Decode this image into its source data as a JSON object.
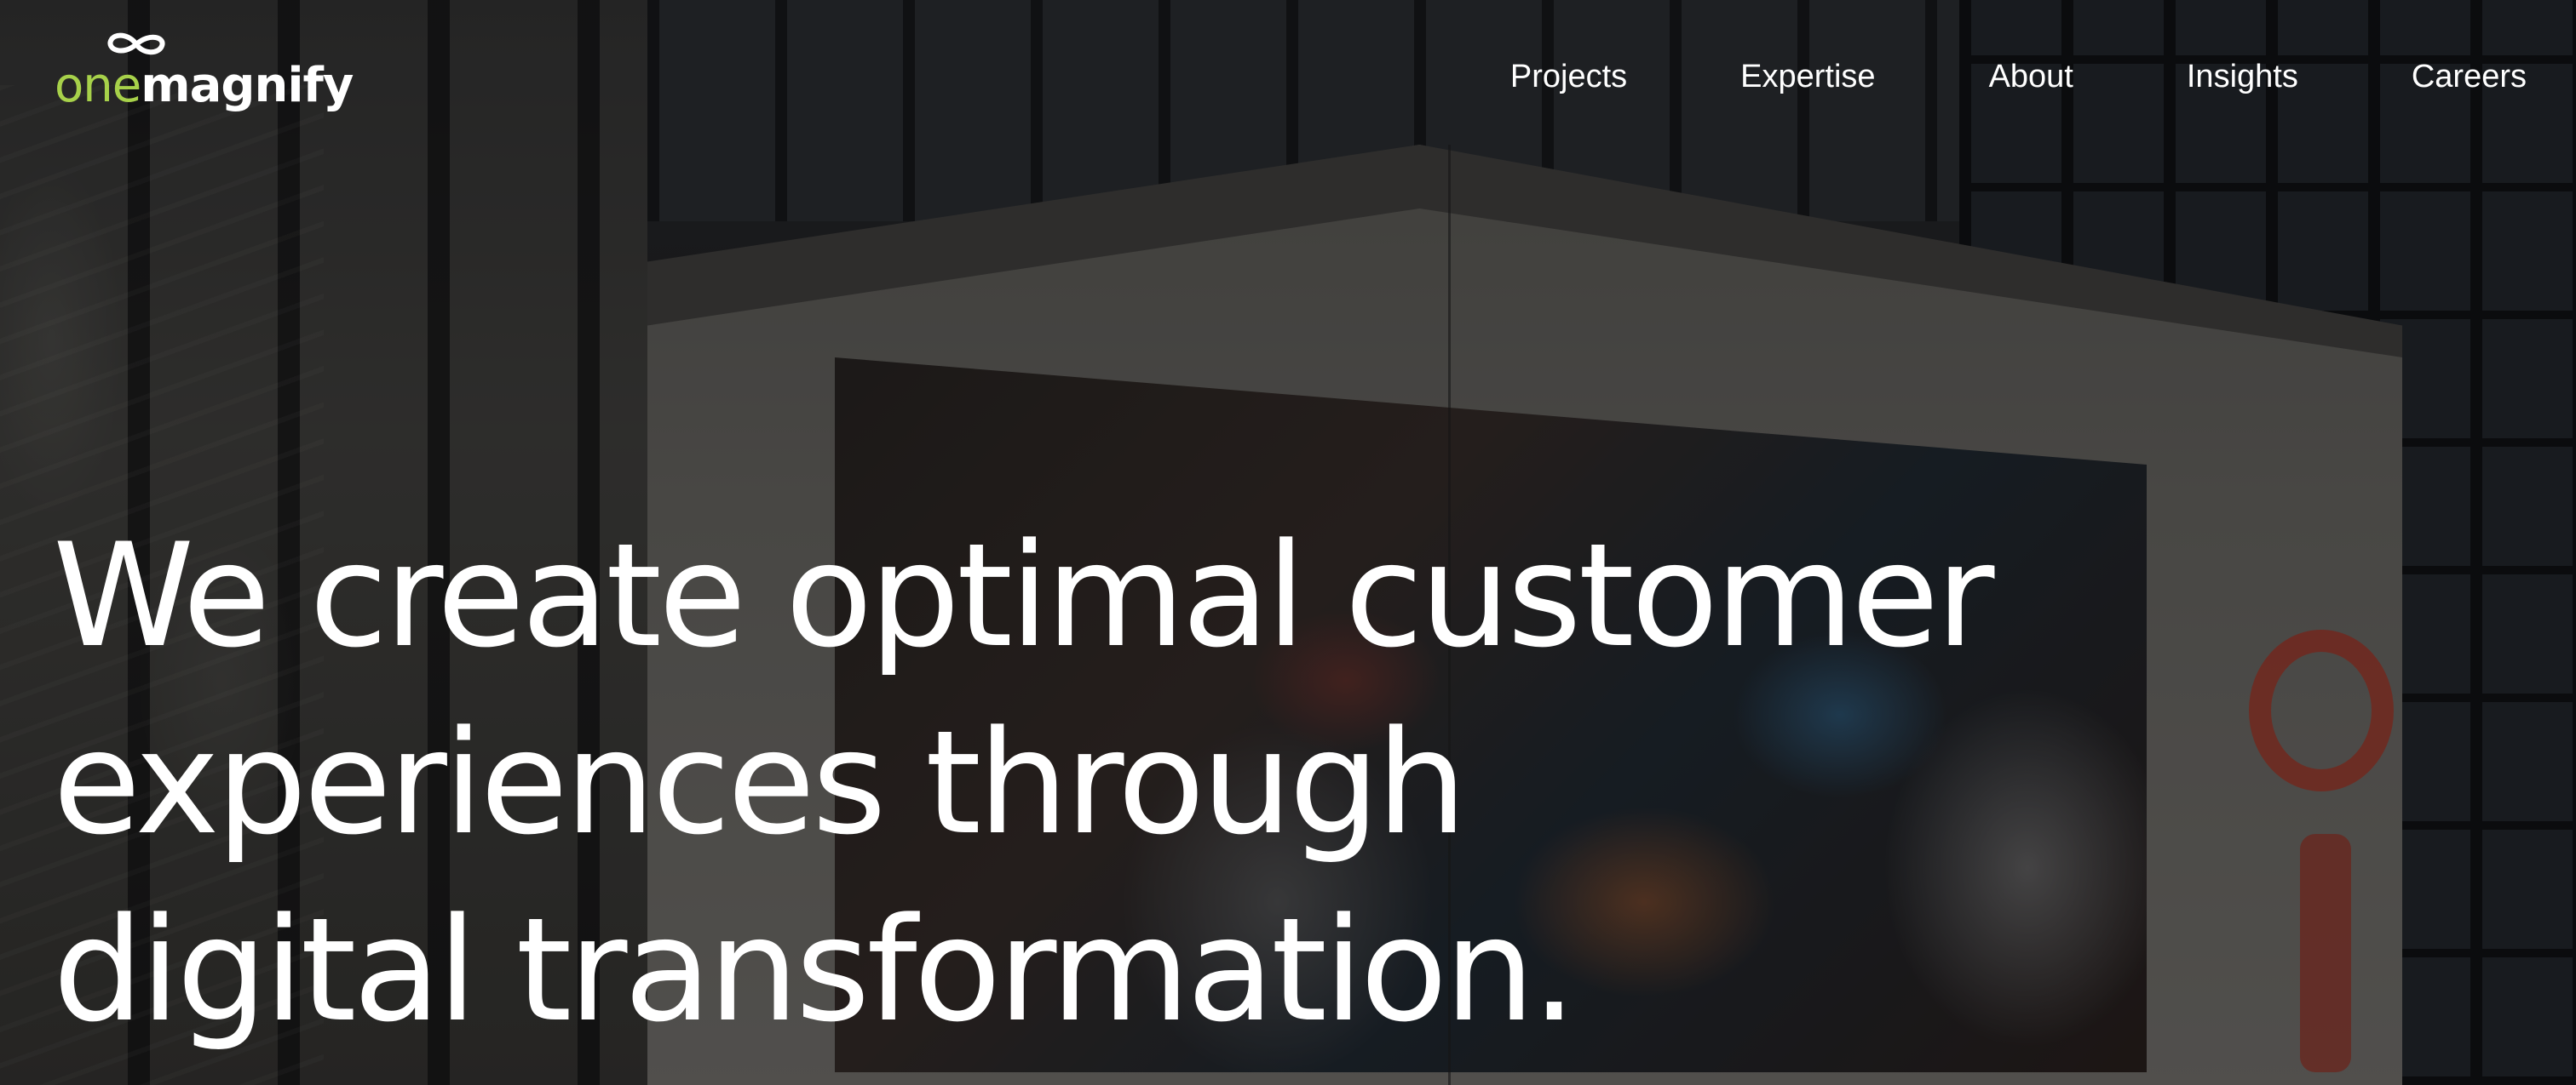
{
  "brand": {
    "logo_one": "one",
    "logo_magnify": "magnify",
    "logo_one_color": "#a7d14a",
    "logo_magnify_color": "#ffffff"
  },
  "nav": {
    "items": [
      {
        "label": "Projects"
      },
      {
        "label": "Expertise"
      },
      {
        "label": "About"
      },
      {
        "label": "Insights"
      },
      {
        "label": "Careers"
      }
    ]
  },
  "hero": {
    "headline_lines": [
      "We create optimal customer",
      "experiences through",
      "digital transformation."
    ],
    "background": "video-still-billboard-building"
  }
}
